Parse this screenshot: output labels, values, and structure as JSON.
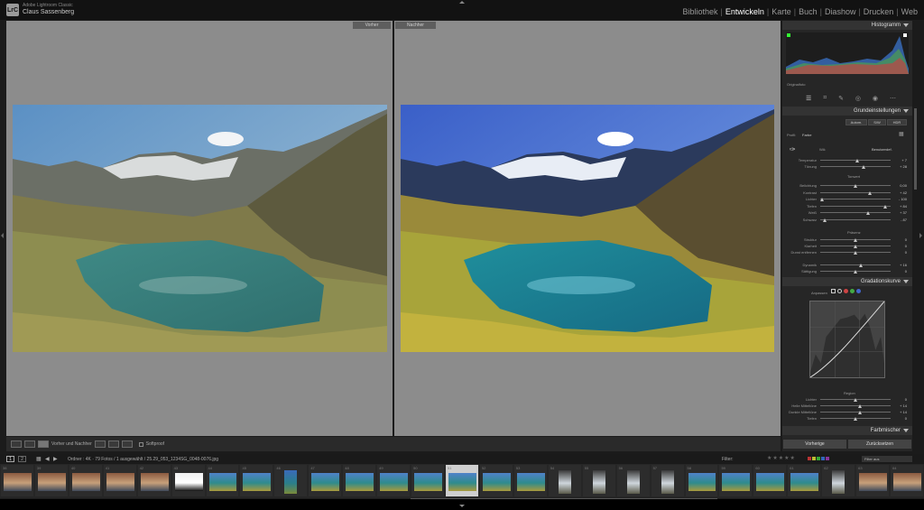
{
  "app": {
    "name": "Adobe Lightroom Classic",
    "user": "Claus Sassenberg",
    "logo": "LrC"
  },
  "modules": [
    {
      "label": "Bibliothek",
      "active": false
    },
    {
      "label": "Entwickeln",
      "active": true
    },
    {
      "label": "Karte",
      "active": false
    },
    {
      "label": "Buch",
      "active": false
    },
    {
      "label": "Diashow",
      "active": false
    },
    {
      "label": "Drucken",
      "active": false
    },
    {
      "label": "Web",
      "active": false
    }
  ],
  "view": {
    "before_label": "Vorher",
    "after_label": "Nachher"
  },
  "toolbar": {
    "mode_label": "Vorher und Nachher",
    "softproof_label": "Softproof"
  },
  "panel": {
    "histogram_title": "Histogramm",
    "original_photo": "Originalfoto",
    "basic_title": "Grundeinstellungen",
    "treatment": {
      "auto": "Autom.",
      "bw": "S/W",
      "hdr": "HDR"
    },
    "profile_label": "Profil:",
    "profile_value": "Farbe",
    "wb_label": "WA:",
    "wb_value": "Benutzerdef.",
    "wb_sliders": [
      {
        "label": "Temperatur",
        "value": "+ 7",
        "pos": 0.52
      },
      {
        "label": "Tönung",
        "value": "+ 28",
        "pos": 0.62
      }
    ],
    "tone_label": "Tonwert",
    "tone_sliders": [
      {
        "label": "Belichtung",
        "value": "0,00",
        "pos": 0.5
      },
      {
        "label": "Kontrast",
        "value": "+ 42",
        "pos": 0.7
      },
      {
        "label": "Lichter",
        "value": "- 100",
        "pos": 0.02
      },
      {
        "label": "Tiefen",
        "value": "+ 84",
        "pos": 0.92
      },
      {
        "label": "Weiß",
        "value": "+ 37",
        "pos": 0.68
      },
      {
        "label": "Schwarz",
        "value": "- 87",
        "pos": 0.07
      }
    ],
    "presence_label": "Präsenz",
    "presence_sliders": [
      {
        "label": "Struktur",
        "value": "0",
        "pos": 0.5
      },
      {
        "label": "Klarheit",
        "value": "0",
        "pos": 0.5
      },
      {
        "label": "Dunst entfernen",
        "value": "0",
        "pos": 0.5
      }
    ],
    "color_sliders": [
      {
        "label": "Dynamik",
        "value": "+ 16",
        "pos": 0.58
      },
      {
        "label": "Sättigung",
        "value": "0",
        "pos": 0.5
      }
    ],
    "curve_title": "Gradationskurve",
    "curve_adjust": "Anpassen",
    "region_label": "Region",
    "region_sliders": [
      {
        "label": "Lichter",
        "value": "0",
        "pos": 0.5
      },
      {
        "label": "Helle Mitteltöne",
        "value": "+ 14",
        "pos": 0.57
      },
      {
        "label": "Dunkle Mitteltöne",
        "value": "+ 14",
        "pos": 0.57
      },
      {
        "label": "Tiefen",
        "value": "0",
        "pos": 0.5
      }
    ],
    "mixer_title": "Farbmischer",
    "prev_button": "Vorherige",
    "reset_button": "Zurücksetzen"
  },
  "filmstrip": {
    "source": "Ordner : 4K · 79 Fotos / 1 ausgewählt / 25.29_053_1234SG_0048-0076.jpg",
    "filter_label": "Filter:",
    "filter_value": "Filter aus",
    "page_a": "1",
    "page_b": "2",
    "thumbs": [
      {
        "num": "38",
        "kind": "people"
      },
      {
        "num": "39",
        "kind": "people"
      },
      {
        "num": "40",
        "kind": "people"
      },
      {
        "num": "41",
        "kind": "people"
      },
      {
        "num": "42",
        "kind": "people"
      },
      {
        "num": "43",
        "kind": "doc"
      },
      {
        "num": "44",
        "kind": "lake"
      },
      {
        "num": "45",
        "kind": "lake"
      },
      {
        "num": "46",
        "kind": "portrait"
      },
      {
        "num": "47",
        "kind": "lake"
      },
      {
        "num": "48",
        "kind": "lake"
      },
      {
        "num": "49",
        "kind": "lake"
      },
      {
        "num": "50",
        "kind": "lake"
      },
      {
        "num": "51",
        "kind": "lake",
        "selected": true
      },
      {
        "num": "52",
        "kind": "lake"
      },
      {
        "num": "53",
        "kind": "lake"
      },
      {
        "num": "54",
        "kind": "waterfall"
      },
      {
        "num": "55",
        "kind": "waterfall"
      },
      {
        "num": "56",
        "kind": "waterfall"
      },
      {
        "num": "57",
        "kind": "waterfall"
      },
      {
        "num": "58",
        "kind": "lake"
      },
      {
        "num": "59",
        "kind": "lake"
      },
      {
        "num": "60",
        "kind": "lake"
      },
      {
        "num": "61",
        "kind": "lake"
      },
      {
        "num": "62",
        "kind": "waterfall"
      },
      {
        "num": "63",
        "kind": "people"
      },
      {
        "num": "64",
        "kind": "people"
      }
    ]
  }
}
